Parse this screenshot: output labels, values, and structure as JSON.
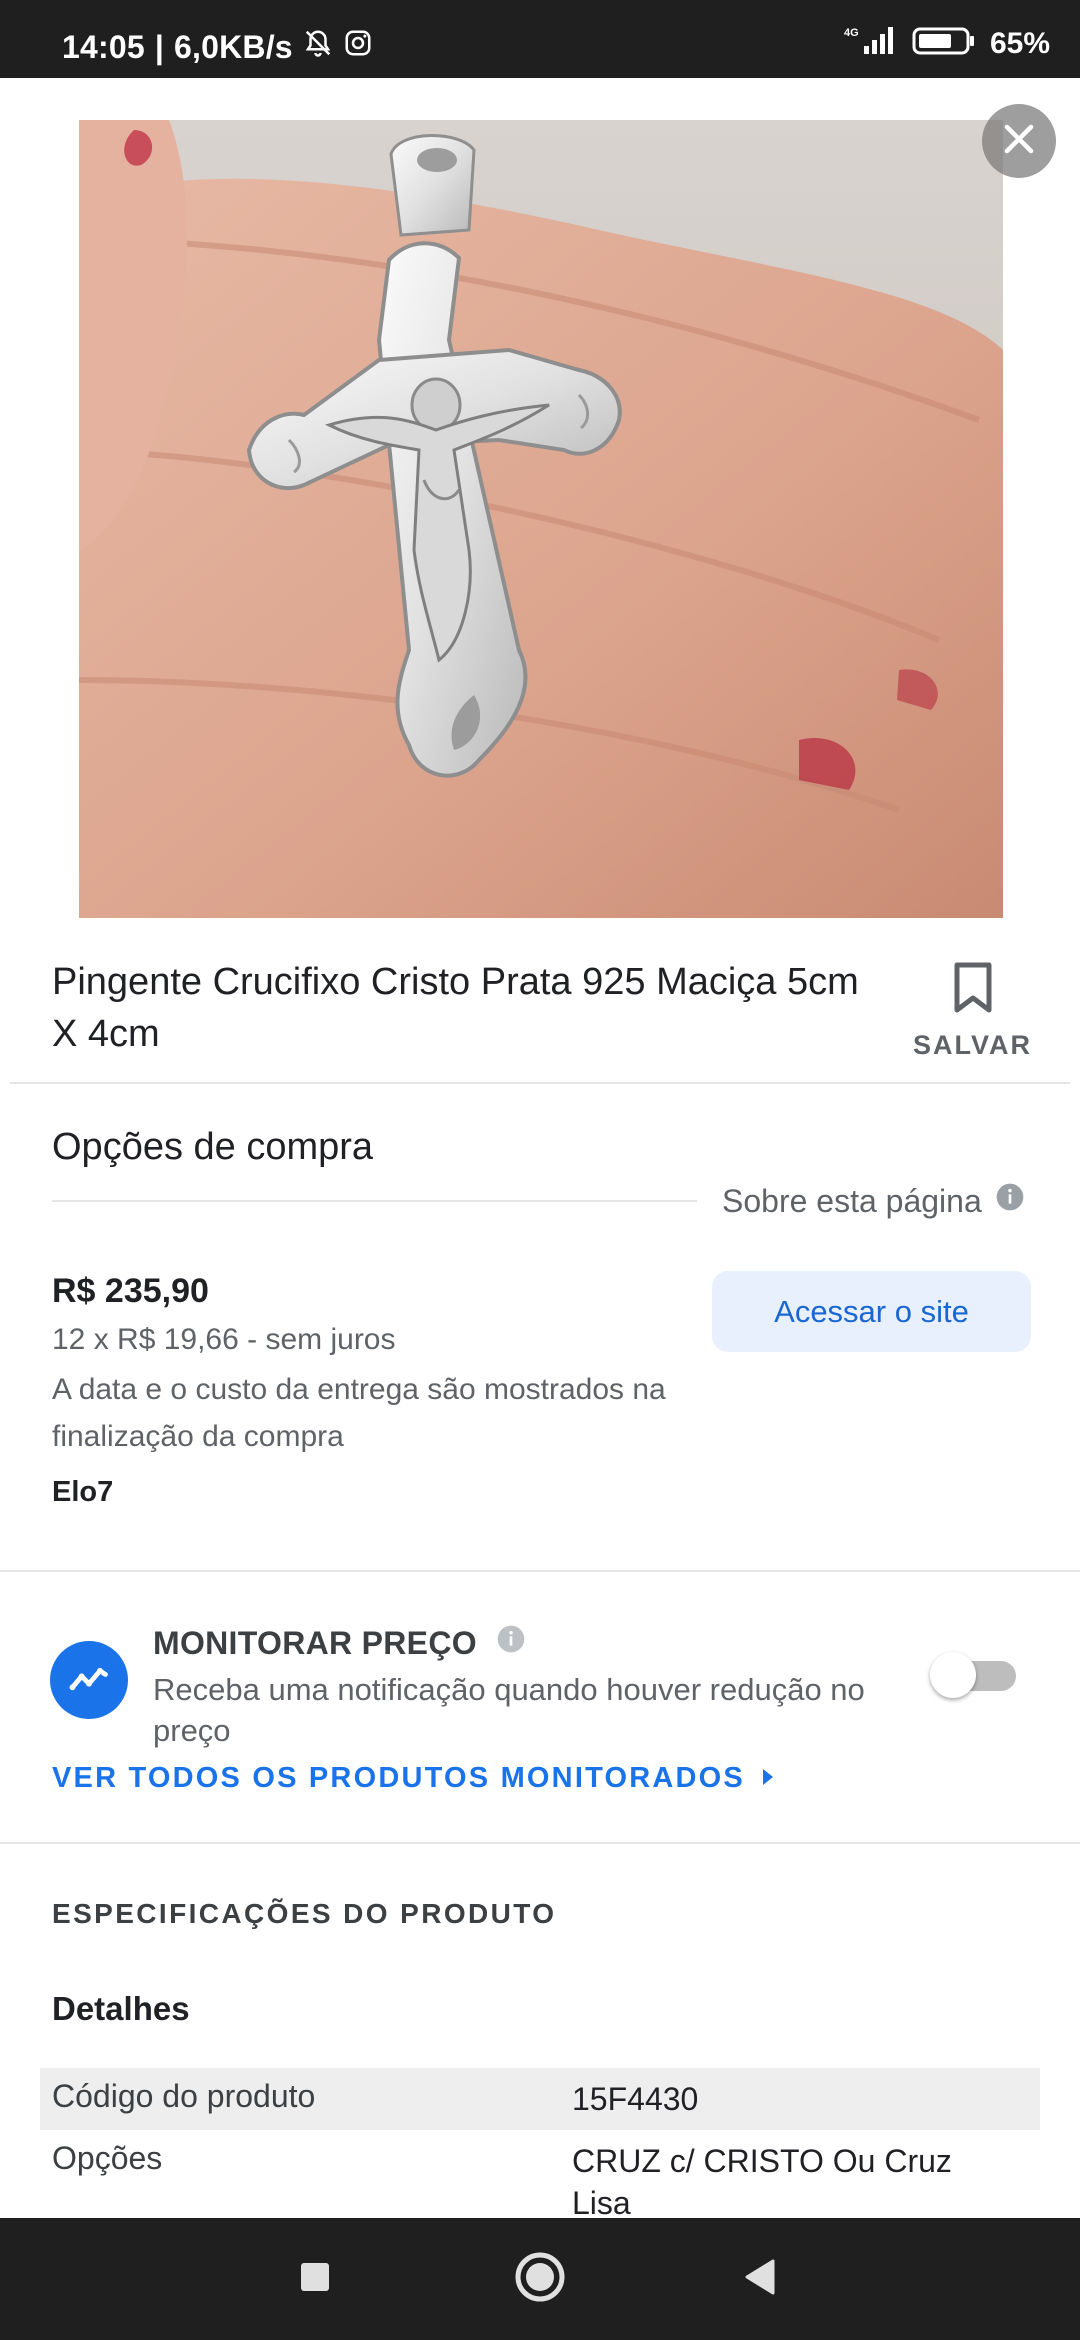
{
  "status_bar": {
    "time": "14:05",
    "speed": "6,0KB/s",
    "network": "4G",
    "battery": "65%"
  },
  "close_label": "Fechar",
  "product": {
    "title": "Pingente Crucifixo Cristo Prata 925 Maciça 5cm X 4cm",
    "save_label": "SALVAR"
  },
  "purchase": {
    "heading": "Opções de compra",
    "about_page": "Sobre esta página",
    "price": "R$ 235,90",
    "installments": "12 x R$ 19,66 - sem juros",
    "delivery_note": "A data e o custo da entrega são mostrados na finalização da compra",
    "seller": "Elo7",
    "visit_button": "Acessar o site"
  },
  "monitor": {
    "title": "MONITORAR PREÇO",
    "description": "Receba uma notificação quando houver redução no preço",
    "toggle_on": false,
    "see_all": "VER TODOS OS PRODUTOS MONITORADOS"
  },
  "specs": {
    "heading": "ESPECIFICAÇÕES DO PRODUTO",
    "details_heading": "Detalhes",
    "rows": [
      {
        "key": "Código do produto",
        "value": "15F4430"
      },
      {
        "key": "Opções",
        "value": "CRUZ c/ CRISTO Ou Cruz Lisa"
      }
    ]
  },
  "colors": {
    "accent": "#1a73e8",
    "button_bg": "#e8f0fe",
    "status_bar": "#1f1f1f"
  }
}
